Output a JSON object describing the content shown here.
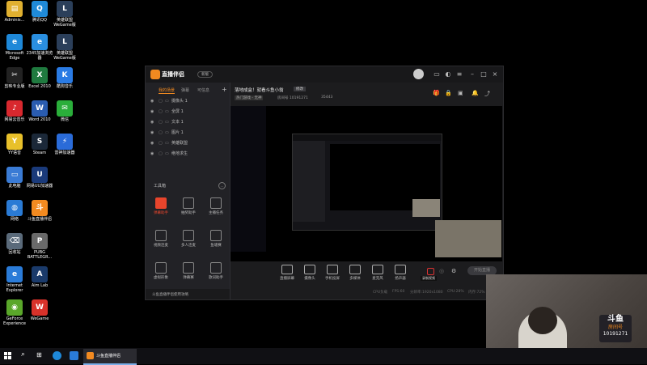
{
  "desktop": {
    "icons": [
      {
        "label": "Adminis...",
        "col": 0,
        "row": 0,
        "color": "#e0b030",
        "glyph": "▤"
      },
      {
        "label": "腾讯QQ",
        "col": 1,
        "row": 0,
        "color": "#1f8ad8",
        "glyph": "Q"
      },
      {
        "label": "英雄联盟 WeGame版",
        "col": 2,
        "row": 0,
        "color": "#2b3f5a",
        "glyph": "L"
      },
      {
        "label": "Microsoft Edge",
        "col": 0,
        "row": 1,
        "color": "#1e88d8",
        "glyph": "e"
      },
      {
        "label": "2345加速浏览器",
        "col": 1,
        "row": 1,
        "color": "#2a8fe0",
        "glyph": "e"
      },
      {
        "label": "英雄联盟 WeGame版",
        "col": 2,
        "row": 1,
        "color": "#2b3f5a",
        "glyph": "L"
      },
      {
        "label": "剪映专业版",
        "col": 0,
        "row": 2,
        "color": "#222",
        "glyph": "✂"
      },
      {
        "label": "Excel 2010",
        "col": 1,
        "row": 2,
        "color": "#1f7a3f",
        "glyph": "X"
      },
      {
        "label": "酷狗音乐",
        "col": 2,
        "row": 2,
        "color": "#2a7be4",
        "glyph": "K"
      },
      {
        "label": "网易云音乐",
        "col": 0,
        "row": 3,
        "color": "#d8282e",
        "glyph": "♪"
      },
      {
        "label": "Word 2010",
        "col": 1,
        "row": 3,
        "color": "#2a5cb0",
        "glyph": "W"
      },
      {
        "label": "微信",
        "col": 2,
        "row": 3,
        "color": "#2aae3a",
        "glyph": "✉"
      },
      {
        "label": "YY语音",
        "col": 0,
        "row": 4,
        "color": "#e8c02a",
        "glyph": "Y"
      },
      {
        "label": "Steam",
        "col": 1,
        "row": 4,
        "color": "#1b2838",
        "glyph": "S"
      },
      {
        "label": "雷神加速器",
        "col": 2,
        "row": 4,
        "color": "#2a6bd8",
        "glyph": "⚡"
      },
      {
        "label": "此电脑",
        "col": 0,
        "row": 5,
        "color": "#3a7bd5",
        "glyph": "▭"
      },
      {
        "label": "网易UU加速器",
        "col": 1,
        "row": 5,
        "color": "#1a3a7a",
        "glyph": "U"
      },
      {
        "label": "网络",
        "col": 0,
        "row": 6,
        "color": "#2a7bd5",
        "glyph": "◍"
      },
      {
        "label": "斗鱼直播伴侣",
        "col": 1,
        "row": 6,
        "color": "#f28a20",
        "glyph": "斗"
      },
      {
        "label": "回收站",
        "col": 0,
        "row": 7,
        "color": "#5a6a7a",
        "glyph": "⌫"
      },
      {
        "label": "PUBG BATTLEGR...",
        "col": 1,
        "row": 7,
        "color": "#6a6a6a",
        "glyph": "P"
      },
      {
        "label": "Internet Explorer",
        "col": 0,
        "row": 8,
        "color": "#2a7bd8",
        "glyph": "e"
      },
      {
        "label": "Aim Lab",
        "col": 1,
        "row": 8,
        "color": "#1a3a6a",
        "glyph": "A"
      },
      {
        "label": "GeForce Experience",
        "col": 0,
        "row": 9,
        "color": "#5aa72a",
        "glyph": "◉"
      },
      {
        "label": "WeGame",
        "col": 1,
        "row": 9,
        "color": "#d8322a",
        "glyph": "W"
      }
    ]
  },
  "app": {
    "logo_text": "直播伴侣",
    "badge": "新版",
    "stream_title": "落地成盒！就看斗鱼小翁",
    "edit_label": "修改",
    "category": "热门游戏 - 无神",
    "room_id": "房间号 10191271",
    "hot_value": "35443",
    "sidebar_tabs": [
      "我的场景",
      "弹幕",
      "可信息"
    ],
    "sources": [
      {
        "name": "摄像头 1"
      },
      {
        "name": "全屏 1"
      },
      {
        "name": "文本 1"
      },
      {
        "name": "图片 1"
      },
      {
        "name": "英雄联盟"
      },
      {
        "name": "绝地求生"
      }
    ],
    "tools_title": "工具箱",
    "tools": [
      {
        "label": "弹幕助手",
        "active": true
      },
      {
        "label": "抽奖助手",
        "active": false
      },
      {
        "label": "主播任务",
        "active": false
      },
      {
        "label": "视频连麦",
        "active": false
      },
      {
        "label": "多人连麦",
        "active": false
      },
      {
        "label": "鱼塘赛",
        "active": false
      },
      {
        "label": "虚拟形象",
        "active": false
      },
      {
        "label": "弹幕赛",
        "active": false
      },
      {
        "label": "歌词助手",
        "active": false
      }
    ],
    "notice": "斗鱼直播伴侣使用攻略",
    "controls": [
      "直播屏幕",
      "摄像头",
      "手机投屏",
      "多媒体",
      "麦克风",
      "扬声器"
    ],
    "start_label": "开始直播",
    "tooltip": "录制视频",
    "status": [
      "CPU负载",
      "FPS:60",
      "分辨率:1920x1080",
      "CPU:28%",
      "内存:72%"
    ]
  },
  "taskbar": {
    "app_label": "斗鱼直播伴侣"
  },
  "webcam": {
    "logo": "斗鱼",
    "room_label": "房间号",
    "room_number": "10191271"
  }
}
